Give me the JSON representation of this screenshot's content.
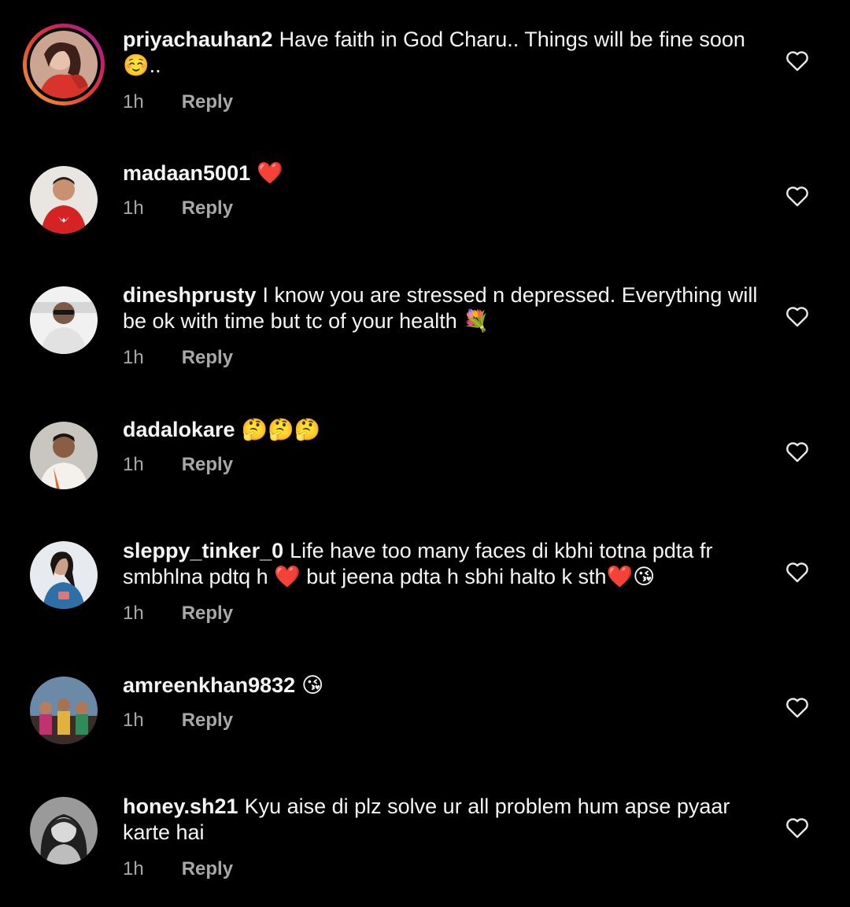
{
  "colors": {
    "background": "#000000",
    "text": "#f5f5f5",
    "meta": "#a8a8a8",
    "heart": "#e6212f",
    "story_ring": [
      "#f7a83b",
      "#e0402f",
      "#c51f6a",
      "#8f2bb0"
    ]
  },
  "comments": [
    {
      "username": "priyachauhan2",
      "text": "Have faith in God Charu.. Things will be fine soon ☺️..",
      "time": "1h",
      "reply_label": "Reply",
      "avatar_icon": "avatar-story-ring",
      "like_icon": "heart-outline-icon"
    },
    {
      "username": "madaan5001",
      "text": "❤️",
      "time": "1h",
      "reply_label": "Reply",
      "avatar_icon": "avatar",
      "like_icon": "heart-outline-icon"
    },
    {
      "username": "dineshprusty",
      "text": "I know you are stressed n depressed. Everything will be ok with time but tc of your health 💐",
      "time": "1h",
      "reply_label": "Reply",
      "avatar_icon": "avatar",
      "like_icon": "heart-outline-icon"
    },
    {
      "username": "dadalokare",
      "text": "🤔🤔🤔",
      "time": "1h",
      "reply_label": "Reply",
      "avatar_icon": "avatar",
      "like_icon": "heart-outline-icon"
    },
    {
      "username": "sleppy_tinker_0",
      "text": "Life have too many faces di kbhi totna pdta fr smbhlna pdtq h ❤️ but jeena pdta h sbhi halto k sth❤️😘",
      "time": "1h",
      "reply_label": "Reply",
      "avatar_icon": "avatar",
      "like_icon": "heart-outline-icon"
    },
    {
      "username": "amreenkhan9832",
      "text": "😘",
      "time": "1h",
      "reply_label": "Reply",
      "avatar_icon": "avatar",
      "like_icon": "heart-outline-icon"
    },
    {
      "username": "honey.sh21",
      "text": "Kyu aise di plz solve ur all problem hum apse pyaar karte hai",
      "time": "1h",
      "reply_label": "Reply",
      "avatar_icon": "avatar",
      "like_icon": "heart-outline-icon"
    }
  ]
}
